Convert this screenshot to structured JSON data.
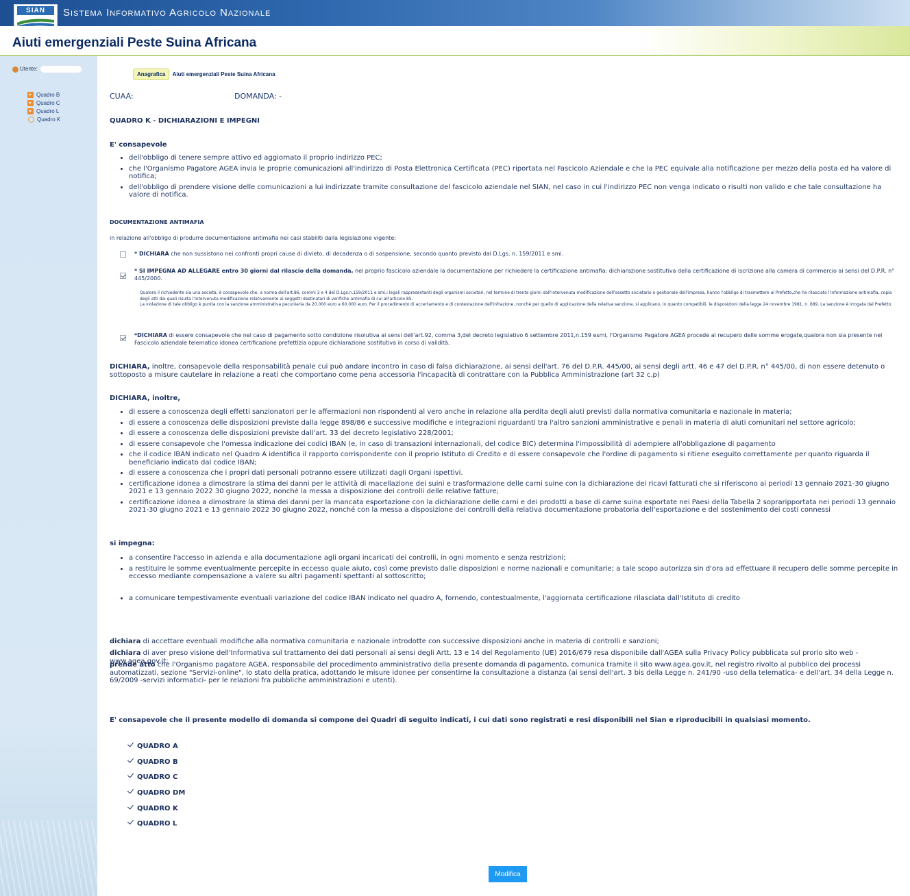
{
  "header": {
    "logo_text": "SIAN",
    "system_name": "Sistema Informativo Agricolo Nazionale",
    "page_title": "Aiuti emergenziali Peste Suina Africana"
  },
  "sidebar": {
    "user_label": "Utente:",
    "items": [
      {
        "label": "Quadro B",
        "icon": "arrow-square-icon"
      },
      {
        "label": "Quadro C",
        "icon": "arrow-square-icon"
      },
      {
        "label": "Quadro L",
        "icon": "arrow-square-icon"
      },
      {
        "label": "Quadro K",
        "icon": "current-dot-icon"
      }
    ]
  },
  "tabs": {
    "anagrafica": "Anagrafica",
    "aiuti": "Aiuti emergenziali Peste Suina Africana"
  },
  "cuaa_label": "CUAA:",
  "domanda_label": "DOMANDA:  -",
  "quadro_title": "QUADRO K - DICHIARAZIONI E IMPEGNI",
  "consapevole": {
    "heading": "E' consapevole",
    "items": [
      "dell'obbligo di tenere sempre attivo ed aggiornato il proprio indirizzo PEC;",
      "che l'Organismo Pagatore AGEA invia le proprie comunicazioni all'indirizzo di Posta Elettronica Certificata (PEC) riportata nel Fascicolo Aziendale e che la PEC equivale alla notificazione per mezzo della posta ed ha valore di notifica;",
      "dell'obbligo di prendere visione delle comunicazioni a lui indirizzate tramite consultazione del fascicolo aziendale nel SIAN, nel caso in cui l'indirizzo PEC non venga indicato o risulti non valido e che tale consultazione ha valore di notifica."
    ]
  },
  "antimafia": {
    "heading": "DOCUMENTAZIONE ANTIMAFIA",
    "intro": "in relazione all'obbligo di produrre documentazione antimafia nei casi stabiliti dalla legislazione vigente:",
    "opt1_bold": "* DICHIARA",
    "opt1_text": " che non sussistono nei confronti propri cause di divieto, di decadenza o di sospensione, secondo quanto previsto dal D.Lgs. n. 159/2011 e smi.",
    "opt1_checked": false,
    "opt2_bold": "* SI IMPEGNA AD ALLEGARE entro 30 giorni dal rilascio della domanda,",
    "opt2_text": " nel proprio fascicolo aziendale la documentazione per richiedere la certificazione antimafia: dichiarazione sostitutiva della certificazione di iscrizione alla camera di commercio ai sensi del D.P.R. n° 445/2000.",
    "opt2_checked": true,
    "note1": "Qualora il richiedente sia una società, è consapevole che, a norma dell'art.86, commi 3 e 4 del D.Lgs.n.159/2011 e smi,i legali rappresentanti degli organismi societari, nel termine di trenta giorni dall'intervenuta modificazione dell'assetto societario o gestionale dell'impresa, hanno l'obbligo di trasmettere al Prefetto,che ha rilasciato l'informazione antimafia, copia degli atti dai quali risulta l'intervenuta modificazione relativamente ai soggetti destinatari di verifiche antimafia di cui all'articolo 85.",
    "note2": "La violazione di tale obbligo è punita con la sanzione amministrativa pecuniaria da 20.000 euro a 60.000 euro. Per il procedimento di accertamento e di contestazione dell'infrazione, nonché per quello di applicazione della relativa sanzione, si applicano, in quanto compatibili, le disposizioni della legge 24 novembre 1981, n. 689. La sanzione è irrogata dal Prefetto.",
    "opt3_bold": "*DICHIARA",
    "opt3_text": " di essere consapevole che nel caso di pagamento sotto condizione risolutiva ai sensi dell'art.92, comma 3,del decreto legislativo 6 settembre 2011,n.159 esmi, l'Organismo Pagatore AGEA procede al recupero delle somme erogate,qualora non sia presente nel Fascicolo aziendale telematico idonea certificazione prefettizia oppure dichiarazione sostitutiva in corso di validità.",
    "opt3_checked": true
  },
  "dichiara_penale": {
    "bold": "DICHIARA,",
    "text": " inoltre, consapevole della responsabilità penale cui può andare incontro in caso di falsa dichiarazione, ai sensi dell'art. 76 del D.P.R. 445/00, ai sensi degli artt. 46 e 47 del D.P.R. n° 445/00, di non essere detenuto o sottoposto a misure cautelare in relazione a reati che comportano come pena accessoria l'incapacità di contrattare con la Pubblica Amministrazione (art 32 c.p)"
  },
  "dichiara_inoltre": {
    "heading": "DICHIARA, inoltre,",
    "items": [
      "di essere a conoscenza degli effetti sanzionatori per le affermazioni non rispondenti al vero anche in relazione alla perdita degli aiuti previsti dalla normativa comunitaria e nazionale in materia;",
      "di essere a conoscenza delle disposizioni previste dalla legge 898/86 e successive modifiche e integrazioni riguardanti tra l'altro sanzioni amministrative e penali in materia di aiuti comunitari nel settore agricolo;",
      "di essere a conoscenza delle disposizioni previste dall'art. 33 del decreto legislativo 228/2001;",
      "di essere consapevole che l'omessa indicazione dei codici IBAN (e, in caso di transazioni internazionali, del codice BIC) determina l'impossibilità di adempiere all'obbligazione di pagamento",
      "che il codice IBAN indicato nel Quadro A identifica il rapporto corrispondente con il proprio Istituto di Credito e di essere consapevole che l'ordine di pagamento si ritiene eseguito correttamente per quanto riguarda il beneficiario indicato dal codice IBAN;",
      "di essere a conoscenza che i propri dati personali potranno essere utilizzati dagli Organi ispettivi.",
      "certificazione idonea a dimostrare la stima dei danni per le attività di macellazione dei suini e trasformazione delle carni suine con la dichiarazione dei ricavi fatturati che si riferiscono ai periodi 13 gennaio 2021-30 giugno 2021 e 13 gennaio 2022 30 giugno 2022, nonché la messa a disposizione dei controlli delle relative fatture;",
      "certificazione idonea a dimostrare la stima dei danni per la mancata esportazione con la dichiarazione delle carni e dei prodotti a base di carne suina esportate nei Paesi della Tabella 2 sopraripportata nei periodi 13 gennaio 2021-30 giugno 2021 e 13 gennaio 2022 30 giugno 2022, nonché con la messa a disposizione dei controlli della relativa documentazione probatoria dell'esportazione e del sostenimento dei costi connessi"
    ]
  },
  "si_impegna": {
    "heading": "si impegna:",
    "items": [
      "a consentire l'accesso in azienda e alla documentazione agli organi incaricati dei controlli, in ogni momento e senza restrizioni;",
      "a restituire le somme eventualmente percepite in eccesso quale aiuto, così come previsto dalle disposizioni e norme nazionali e comunitarie; a tale scopo autorizza sin d'ora ad effettuare il recupero delle somme percepite in eccesso mediante compensazione a valere su altri pagamenti spettanti al sottoscritto;",
      "a comunicare tempestivamente eventuali variazione del codice IBAN indicato nel quadro A, fornendo, contestualmente, l'aggiornata certificazione rilasciata dall'Istituto di credito"
    ]
  },
  "final": {
    "d1_bold": "dichiara",
    "d1_text": " di accettare eventuali modifiche alla normativa comunitaria e nazionale introdotte con successive disposizioni anche in materia di controlli e sanzioni;",
    "d2_bold": "dichiara",
    "d2_text": " di aver preso visione dell'Informativa sul trattamento dei dati personali ai sensi degli Artt. 13 e 14 del Regolamento (UE) 2016/679 resa disponibile dall'AGEA sulla Privacy Policy pubblicata sul prorio sito web - www.agea.gov.it;",
    "d3_bold": "prende atto",
    "d3_text": " che l'Organismo pagatore AGEA, responsabile del procedimento amministrativo della presente domanda di pagamento, comunica tramite il sito www.agea.gov.it, nel registro rivolto al pubblico dei processi automatizzati, sezione \"Servizi-online\", lo stato della pratica, adottando le misure idonee per consentirne la consultazione a distanza (ai sensi dell'art. 3 bis della Legge n. 241/90 -uso della telematica- e dell'art. 34 della Legge n. 69/2009 -servizi informatici- per le relazioni fra pubbliche amministrazioni e utenti)."
  },
  "quadri_intro": "E' consapevole che il presente modello di domanda si compone dei Quadri di seguito indicati, i cui dati sono registrati e resi disponibili nel Sian e riproducibili in qualsiasi momento.",
  "quadri": [
    "QUADRO A",
    "QUADRO B",
    "QUADRO C",
    "QUADRO DM",
    "QUADRO K",
    "QUADRO L"
  ],
  "modifica_label": "Modifica",
  "colors": {
    "header_blue": "#1d4f92",
    "title_navy": "#0b2a63",
    "button_blue": "#1e9af2",
    "sidebar": "#d6e6f4"
  }
}
